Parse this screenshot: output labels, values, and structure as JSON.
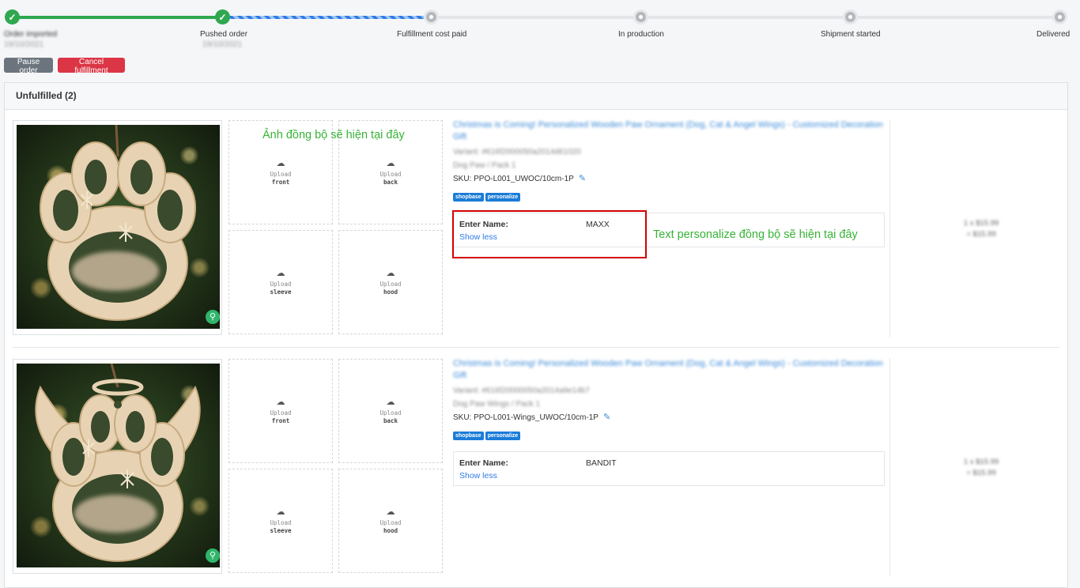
{
  "progress": {
    "steps": [
      {
        "label": "Order imported",
        "date": "19/10/2021",
        "state": "done"
      },
      {
        "label": "Pushed order",
        "date": "19/10/2021",
        "state": "done"
      },
      {
        "label": "Fulfillment cost paid",
        "date": "",
        "state": "todo"
      },
      {
        "label": "In production",
        "date": "",
        "state": "todo"
      },
      {
        "label": "Shipment started",
        "date": "",
        "state": "todo"
      },
      {
        "label": "Delivered",
        "date": "",
        "state": "todo"
      }
    ]
  },
  "actions": {
    "pause": "Pause order",
    "cancel": "Cancel fulfillment"
  },
  "section": {
    "title": "Unfulfilled (2)"
  },
  "upload": {
    "word": "Upload",
    "slots": [
      "front",
      "back",
      "sleeve",
      "hood"
    ]
  },
  "items": [
    {
      "title": "Christmas is Coming! Personalized Wooden Paw Ornament (Dog, Cat & Angel Wings) - Customized Decoration Gift",
      "variant": "Variant: #616f2000050a2014d61020",
      "option": "Dog Paw / Pack 1",
      "sku": "SKU:  PPO-L001_UWOC/10cm-1P",
      "tags": [
        "shopbase",
        "personalize"
      ],
      "personalize_label": "Enter Name:",
      "personalize_value": "MAXX",
      "toggle": "Show less",
      "qty": "1 x $15.99",
      "total": "= $15.99"
    },
    {
      "title": "Christmas is Coming! Personalized Wooden Paw Ornament (Dog, Cat & Angel Wings) - Customized Decoration Gift",
      "variant": "Variant: #616f20000050a2014a9e14b7",
      "option": "Dog Paw Wings / Pack 1",
      "sku": "SKU:  PPO-L001-Wings_UWOC/10cm-1P",
      "tags": [
        "shopbase",
        "personalize"
      ],
      "personalize_label": "Enter Name:",
      "personalize_value": "BANDIT",
      "toggle": "Show less",
      "qty": "1 x $15.99",
      "total": "= $15.99"
    }
  ],
  "annotations": {
    "image_sync": "Ảnh đồng bộ sẽ hiện tại đây",
    "text_sync": "Text personalize đồng bộ sẽ hiện tại đây"
  },
  "icons": {
    "check": "check-icon",
    "cloud": "cloud-upload-icon",
    "zoom": "zoom-icon",
    "edit": "edit-icon"
  },
  "colors": {
    "success": "#2fa84f",
    "primary": "#2e7be6",
    "danger": "#dc3545",
    "annotation": "#36b336"
  }
}
